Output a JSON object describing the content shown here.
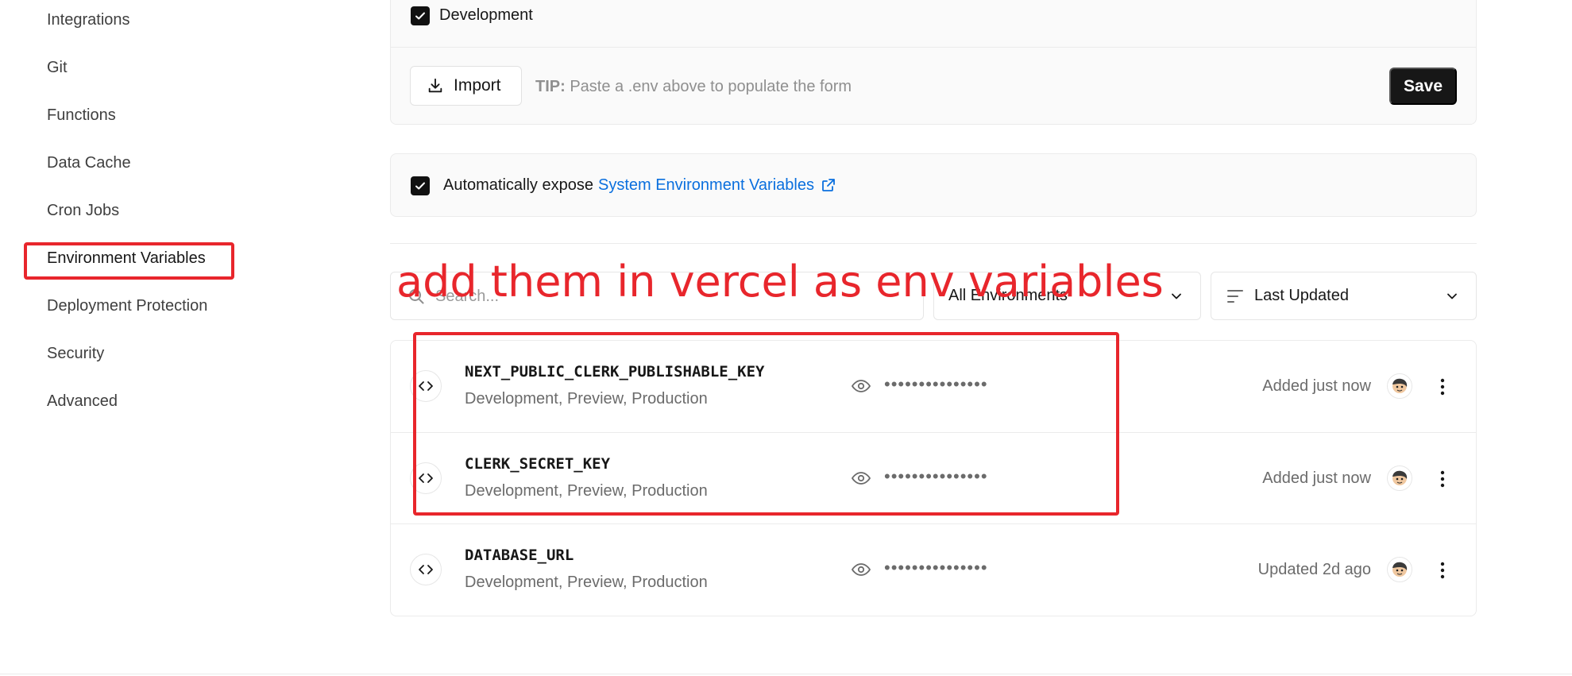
{
  "sidebar": {
    "items": [
      {
        "label": "Integrations"
      },
      {
        "label": "Git"
      },
      {
        "label": "Functions"
      },
      {
        "label": "Data Cache"
      },
      {
        "label": "Cron Jobs"
      },
      {
        "label": "Environment Variables",
        "active": true
      },
      {
        "label": "Deployment Protection"
      },
      {
        "label": "Security"
      },
      {
        "label": "Advanced"
      }
    ]
  },
  "form": {
    "environment_checkbox_label": "Development",
    "import_label": "Import",
    "tip_prefix": "TIP:",
    "tip_text": "Paste a .env above to populate the form",
    "save_label": "Save"
  },
  "expose": {
    "text": "Automatically expose",
    "link_text": "System Environment Variables"
  },
  "filters": {
    "search_placeholder": "Search...",
    "environment_select": "All Environments",
    "sort_select": "Last Updated"
  },
  "annotation": {
    "text": "add them in vercel as env variables"
  },
  "variables": [
    {
      "name": "NEXT_PUBLIC_CLERK_PUBLISHABLE_KEY",
      "environments": "Development, Preview, Production",
      "masked_value": "•••••••••••••••",
      "status": "Added just now"
    },
    {
      "name": "CLERK_SECRET_KEY",
      "environments": "Development, Preview, Production",
      "masked_value": "•••••••••••••••",
      "status": "Added just now"
    },
    {
      "name": "DATABASE_URL",
      "environments": "Development, Preview, Production",
      "masked_value": "•••••••••••••••",
      "status": "Updated 2d ago"
    }
  ],
  "colors": {
    "annotation_red": "#e8262c",
    "link_blue": "#0a6fde",
    "primary_dark": "#171717"
  }
}
